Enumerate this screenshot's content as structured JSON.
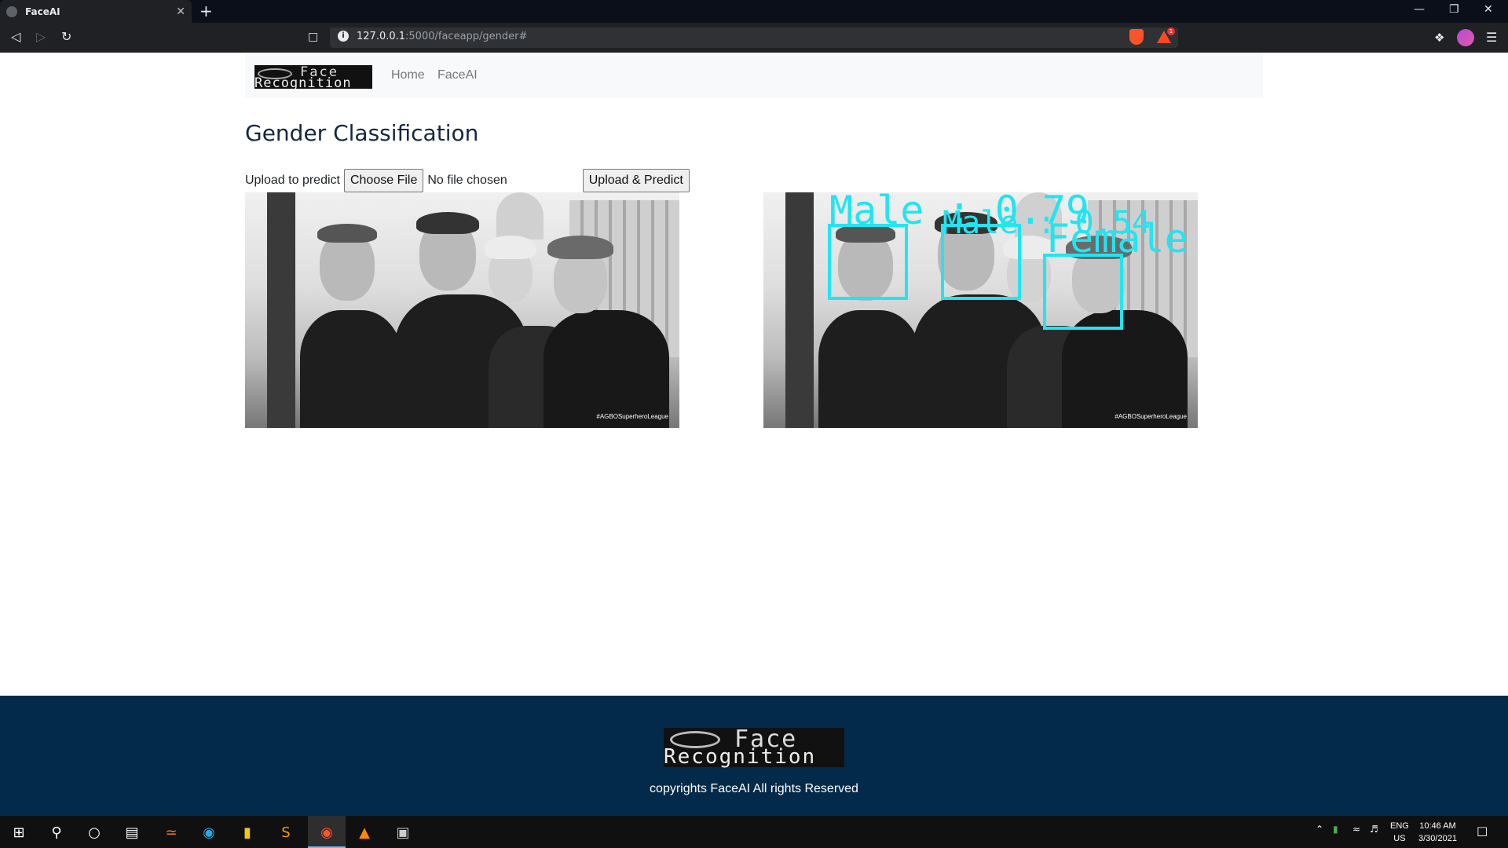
{
  "browser": {
    "tab_title": "FaceAI",
    "tab_close": "✕",
    "new_tab": "+",
    "url_host": "127.0.0.1",
    "url_rest": ":5000/faceapp/gender#",
    "alert_count": "1"
  },
  "navbar": {
    "logo_line1": "Face",
    "logo_line2": "Recognition",
    "links": [
      "Home",
      "FaceAI"
    ]
  },
  "page": {
    "heading": "Gender Classification",
    "upload_label": "Upload to predict",
    "choose_file": "Choose File",
    "file_status": "No file chosen",
    "submit": "Upload & Predict"
  },
  "images": {
    "watermark": "#AGBOSuperheroLeague",
    "detection_color": "#21e5f0",
    "detections": [
      {
        "label": "Male : 0.79"
      },
      {
        "label": "Male : 0.54"
      },
      {
        "label": "Female"
      }
    ]
  },
  "footer": {
    "logo_line1": "Face",
    "logo_line2": "Recognition",
    "copyright": "copyrights FaceAI All rights Reserved"
  },
  "taskbar": {
    "lang_top": "ENG",
    "lang_bottom": "US",
    "time": "10:46 AM",
    "date": "3/30/2021"
  }
}
